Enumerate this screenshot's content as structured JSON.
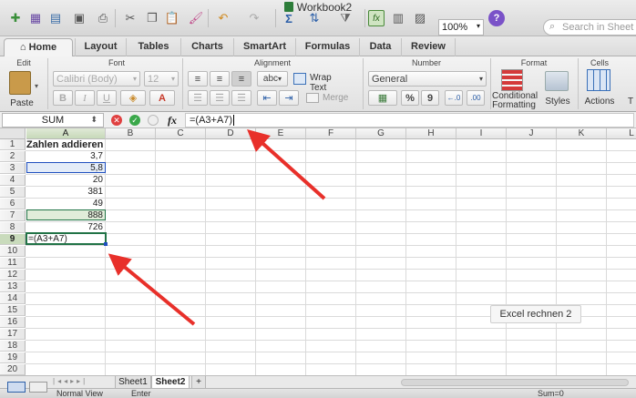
{
  "window": {
    "title": "Workbook2"
  },
  "toolbar": {
    "zoom": "100%",
    "search_placeholder": "Search in Sheet"
  },
  "tabs": [
    "Home",
    "Layout",
    "Tables",
    "Charts",
    "SmartArt",
    "Formulas",
    "Data",
    "Review"
  ],
  "ribbon": {
    "groups": {
      "edit": "Edit",
      "font": "Font",
      "alignment": "Alignment",
      "number": "Number",
      "format": "Format",
      "cells": "Cells"
    },
    "paste": "Paste",
    "font_name": "Calibri (Body)",
    "font_size": "12",
    "bold": "B",
    "italic": "I",
    "underline": "U",
    "wrap_text": "Wrap Text",
    "merge": "Merge",
    "abc": "abc",
    "number_format": "General",
    "percent": "%",
    "comma": "9",
    "conditional_formatting": [
      "Conditional",
      "Formatting"
    ],
    "styles": "Styles",
    "actions": "Actions",
    "tf": "T"
  },
  "formula_bar": {
    "name_box": "SUM",
    "fx": "fx",
    "formula": "=(A3+A7)"
  },
  "columns": [
    "A",
    "B",
    "C",
    "D",
    "E",
    "F",
    "G",
    "H",
    "I",
    "J",
    "K",
    "L"
  ],
  "rows": [
    "1",
    "2",
    "3",
    "4",
    "5",
    "6",
    "7",
    "8",
    "9",
    "10",
    "11",
    "12",
    "13",
    "14",
    "15",
    "16",
    "17",
    "18",
    "19",
    "20",
    "21"
  ],
  "cells": [
    {
      "row": 1,
      "value": "Zahlen addieren",
      "style": "bold"
    },
    {
      "row": 2,
      "value": "3,7",
      "style": "num"
    },
    {
      "row": 3,
      "value": "5,8",
      "style": "num"
    },
    {
      "row": 4,
      "value": "20",
      "style": "num"
    },
    {
      "row": 5,
      "value": "381",
      "style": "num"
    },
    {
      "row": 6,
      "value": "49",
      "style": "num"
    },
    {
      "row": 7,
      "value": "888",
      "style": "num"
    },
    {
      "row": 8,
      "value": "726",
      "style": "num"
    },
    {
      "row": 9,
      "value": "=(A3+A7)",
      "style": "edit"
    }
  ],
  "tooltip": "Excel rechnen 2",
  "sheets": [
    "Sheet1",
    "Sheet2"
  ],
  "add_sheet": "+",
  "status": {
    "view": "Normal View",
    "mode": "Enter",
    "sum": "Sum=0"
  },
  "colors": {
    "selection_green": "#217346",
    "ref_blue": "#1f4fbf",
    "arrow_red": "#e8302a"
  }
}
